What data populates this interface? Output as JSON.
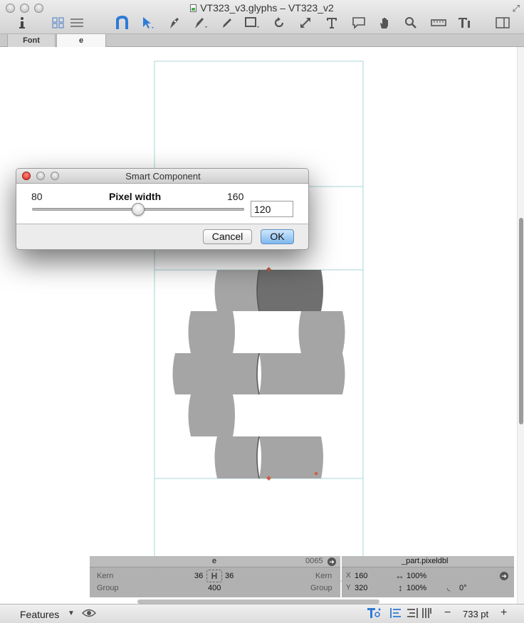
{
  "window": {
    "title": "VT323_v3.glyphs – VT323_v2"
  },
  "toolbar": {
    "tools": [
      "info-icon",
      "grid-view-icon",
      "list-view-icon",
      "text-tool-icon",
      "select-tool-icon",
      "draw-tool-icon",
      "pen-tool-icon",
      "pencil-tool-icon",
      "rectangle-tool-icon",
      "rotate-tool-icon",
      "scale-tool-icon",
      "type-tool-icon",
      "annotation-tool-icon",
      "hand-tool-icon",
      "zoom-tool-icon",
      "measure-tool-icon",
      "text-format-icon",
      "sidebar-icon"
    ],
    "active_tool": "select-tool-icon",
    "accent_color": "#2f7bd6"
  },
  "tabs": [
    {
      "label": "Font"
    },
    {
      "label": "e"
    }
  ],
  "dialog": {
    "title": "Smart Component",
    "slider_min": "80",
    "slider_label": "Pixel width",
    "slider_max": "160",
    "value": "120",
    "cancel_label": "Cancel",
    "ok_label": "OK"
  },
  "glyph_info": {
    "glyph_name": "e",
    "unicode": "0065",
    "kern_label_left": "Kern",
    "kern_left": "36",
    "kern_right": "36",
    "kern_label_right": "Kern",
    "group_label_left": "Group",
    "width": "400",
    "group_label_right": "Group"
  },
  "component_info": {
    "name": "_part.pixeldbl",
    "x_label": "X",
    "x": "160",
    "scale_x": "100%",
    "y_label": "Y",
    "y": "320",
    "scale_y": "100%",
    "angle": "0°"
  },
  "bottom_bar": {
    "features_label": "Features",
    "zoom_label": "733 pt",
    "minus_label": "−",
    "plus_label": "+"
  },
  "colors": {
    "guide": "#a9d4d9",
    "shape_light": "#a5a5a5",
    "shape_dark": "#6f6f6f",
    "node": "#c8624a"
  }
}
